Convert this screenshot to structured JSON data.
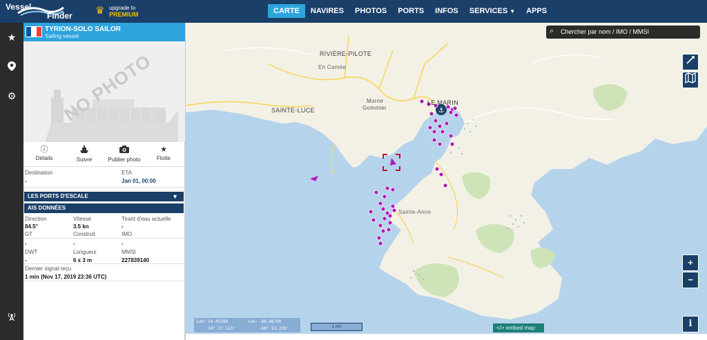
{
  "brand": {
    "line1": "Vessel",
    "line2": "Finder"
  },
  "premium": {
    "line1": "upgrade to",
    "line2": "PREMIUM"
  },
  "nav": [
    {
      "label": "CARTE",
      "active": true
    },
    {
      "label": "NAVIRES"
    },
    {
      "label": "PHOTOS"
    },
    {
      "label": "PORTS"
    },
    {
      "label": "INFOS"
    },
    {
      "label": "SERVICES"
    },
    {
      "label": "APPS"
    }
  ],
  "vessel": {
    "name": "TYRION-SOLO SAILOR",
    "type": "Sailing vessel",
    "flag_colors": [
      "#0055a4",
      "#ffffff",
      "#ef4135"
    ],
    "photo_placeholder": "NO PHOTO"
  },
  "actions": [
    {
      "label": "Détails",
      "icon": "info-icon"
    },
    {
      "label": "Suivre",
      "icon": "ship-icon"
    },
    {
      "label": "Publier photo",
      "icon": "camera-icon"
    },
    {
      "label": "Flotte",
      "icon": "star-icon"
    }
  ],
  "voyage": {
    "destination_label": "Destination",
    "destination_value": "-",
    "eta_label": "ETA",
    "eta_value": "Jan 01, 00:00"
  },
  "sections": {
    "ports": "LES PORTS D'ESCALE",
    "ais": "AIS DONNÉES"
  },
  "ais": {
    "direction_label": "Direction",
    "direction_value": "84.5°",
    "speed_label": "Vitesse",
    "speed_value": "3.5 kn",
    "draught_label": "Tirant d'eau actuelle",
    "draught_value": "-",
    "gt_label": "GT",
    "gt_value": "-",
    "built_label": "Construit",
    "built_value": "-",
    "imo_label": "IMO",
    "imo_value": "-",
    "dwt_label": "DWT",
    "dwt_value": "-",
    "length_label": "Longueur",
    "length_value": "6 x 3 m",
    "mmsi_label": "MMSI",
    "mmsi_value": "227839140",
    "last_signal_label": "Dernier signal reçu",
    "last_signal_value": "1 min (Nov 17, 2019 23:36 UTC)"
  },
  "map": {
    "search_placeholder": "Chercher par nom / IMO / MMSI",
    "labels": {
      "riviere_pilote": "RIVIÈRE-PILOTE",
      "en_camee": "En Camée",
      "morne": "Morne",
      "gommier": "Gommier",
      "sainte_luce": "SAINTE-LUCE",
      "le_marin": "LE MARIN",
      "sainte_anne": "Sainte-Anne"
    },
    "coords": {
      "lat_label": "Lat:",
      "lat_value": "14.45189",
      "lon_label": "Lon:",
      "lon_value": "-60.88700",
      "lat_dms": "14° 27.113'",
      "lon_dms": "-60° 53.220'"
    },
    "scale": "1 nm",
    "embed": "</> embed map",
    "zoom_in": "+",
    "zoom_out": "−",
    "info": "i",
    "colors": {
      "water": "#b6d3ec",
      "land": "#f3f1e6",
      "green": "#cfe3b8",
      "vessel": "#b21db7",
      "road": "#f7d868"
    }
  }
}
